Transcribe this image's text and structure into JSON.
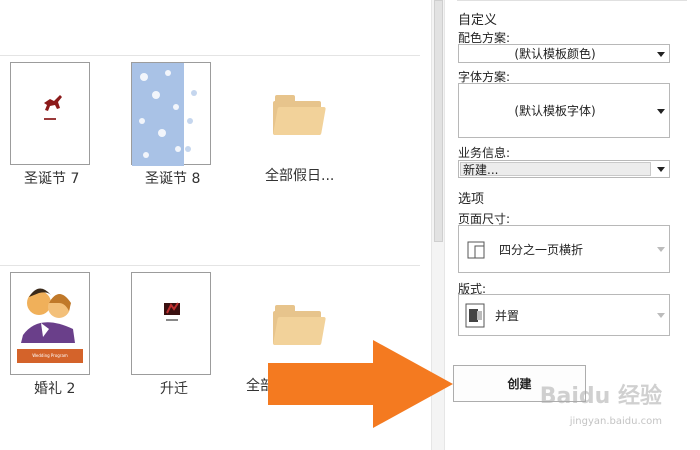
{
  "gallery": {
    "row1": [
      {
        "label": "圣诞节 7"
      },
      {
        "label": "圣诞节 8"
      },
      {
        "label": "全部假日..."
      }
    ],
    "row2": [
      {
        "label": "婚礼 2",
        "banner_text": "Wedding Program"
      },
      {
        "label": "升迁"
      },
      {
        "label": "全部"
      }
    ]
  },
  "panel": {
    "section_custom": "自定义",
    "color_scheme_label": "配色方案:",
    "color_scheme_value": "(默认模板颜色)",
    "font_scheme_label": "字体方案:",
    "font_scheme_value": "(默认模板字体)",
    "business_info_label": "业务信息:",
    "business_info_value": "新建...",
    "section_options": "选项",
    "page_size_label": "页面尺寸:",
    "page_size_value": "四分之一页横折",
    "layout_label": "版式:",
    "layout_value": "并置",
    "create_button": "创建"
  },
  "overlay": {
    "arrow_color": "#f47a20",
    "watermark": "Baidu 经验",
    "watermark_url": "jingyan.baidu.com"
  }
}
